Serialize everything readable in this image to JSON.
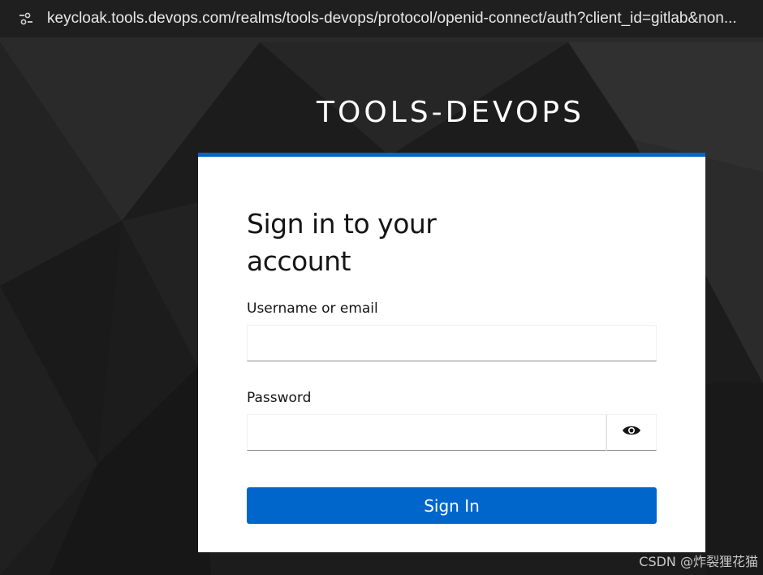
{
  "browser": {
    "url": "keycloak.tools.devops.com/realms/tools-devops/protocol/openid-connect/auth?client_id=gitlab&non...",
    "site_info_icon": "tune-icon"
  },
  "realm": {
    "title": "TOOLS-DEVOPS"
  },
  "login": {
    "heading": "Sign in to your account",
    "username_label": "Username or email",
    "username_value": "",
    "password_label": "Password",
    "password_value": "",
    "show_password_icon": "eye-icon",
    "submit_label": "Sign In"
  },
  "colors": {
    "accent": "#0066cc",
    "background": "#1e1e1e"
  },
  "watermark": "CSDN @炸裂狸花猫"
}
